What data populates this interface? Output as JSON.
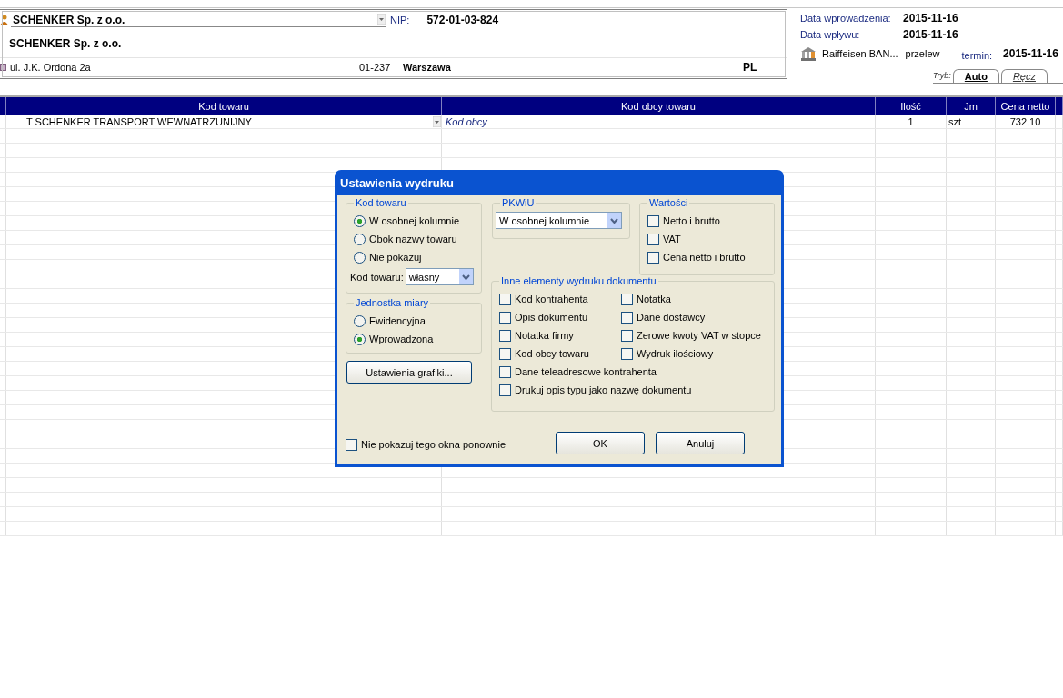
{
  "contractor": {
    "name_combo": "SCHENKER Sp. z o.o.",
    "nip_label": "NIP:",
    "nip": "572-01-03-824",
    "name": "SCHENKER Sp. z o.o.",
    "street": "ul. J.K. Ordona 2a",
    "postal_code": "01-237",
    "city": "Warszawa",
    "country": "PL"
  },
  "document": {
    "fields": [
      {
        "label": "Data wprowadzenia:",
        "value": "2015-11-16"
      },
      {
        "label": "Data wpływu:",
        "value": "2015-11-16"
      }
    ],
    "bank": "Raiffeisen BAN...",
    "payment": "przelew",
    "due_label": "termin:",
    "due": "2015-11-16"
  },
  "mode": {
    "label": "Tryb:",
    "tabs": [
      {
        "label": "Auto",
        "selected": true
      },
      {
        "label": "Ręcz",
        "selected": false
      }
    ]
  },
  "table": {
    "columns": [
      "Kod towaru",
      "Kod obcy towaru",
      "Ilość",
      "Jm",
      "Cena netto"
    ],
    "rows": [
      {
        "code": "T SCHENKER TRANSPORT WEWNATRZUNIJNY",
        "foreign_code": "Kod obcy",
        "qty": "1",
        "unit": "szt",
        "price": "732,10"
      }
    ]
  },
  "dialog": {
    "title": "Ustawienia wydruku",
    "code_group": {
      "title": "Kod towaru",
      "options": [
        {
          "label": "W osobnej kolumnie",
          "selected": true
        },
        {
          "label": "Obok nazwy towaru",
          "selected": false
        },
        {
          "label": "Nie pokazuj",
          "selected": false
        }
      ],
      "select_label": "Kod towaru:",
      "select_value": "własny"
    },
    "unit_group": {
      "title": "Jednostka miary",
      "options": [
        {
          "label": "Ewidencyjna",
          "selected": false
        },
        {
          "label": "Wprowadzona",
          "selected": true
        }
      ]
    },
    "graphics_button": "Ustawienia grafiki...",
    "pkwiu_group": {
      "title": "PKWiU",
      "value": "W osobnej kolumnie"
    },
    "values_group": {
      "title": "Wartości",
      "options": [
        {
          "label": "Netto i brutto",
          "checked": false
        },
        {
          "label": "VAT",
          "checked": false
        },
        {
          "label": "Cena netto i brutto",
          "checked": false
        }
      ]
    },
    "other_group": {
      "title": "Inne elementy wydruku dokumentu",
      "options": [
        {
          "label": "Kod kontrahenta",
          "checked": false
        },
        {
          "label": "Notatka",
          "checked": false
        },
        {
          "label": "Opis dokumentu",
          "checked": false
        },
        {
          "label": "Dane dostawcy",
          "checked": false
        },
        {
          "label": "Notatka firmy",
          "checked": false
        },
        {
          "label": "Zerowe kwoty VAT w stopce",
          "checked": false
        },
        {
          "label": "Kod obcy towaru",
          "checked": false
        },
        {
          "label": "Wydruk ilościowy",
          "checked": false
        },
        {
          "label": "Dane teleadresowe kontrahenta",
          "checked": false
        },
        {
          "label": "Drukuj opis typu jako nazwę dokumentu",
          "checked": false
        }
      ]
    },
    "dont_show": {
      "label": "Nie pokazuj tego okna ponownie",
      "checked": false
    },
    "buttons": [
      "OK",
      "Anuluj"
    ]
  }
}
